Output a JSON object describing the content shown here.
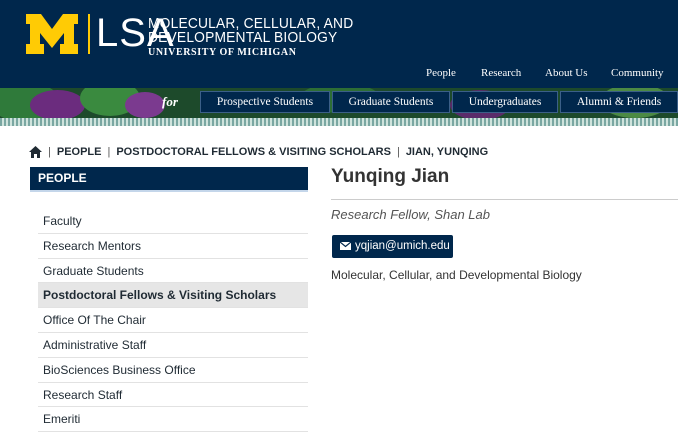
{
  "header": {
    "logo_text": "LSA",
    "department": {
      "line1": "MOLECULAR, CELLULAR, AND",
      "line2": "DEVELOPMENTAL BIOLOGY",
      "line3": "UNIVERSITY OF MICHIGAN"
    },
    "top_nav": [
      "People",
      "Research",
      "About Us",
      "Community"
    ],
    "for_label": "for",
    "audience_tabs": [
      "Prospective Students",
      "Graduate Students",
      "Undergraduates",
      "Alumni & Friends"
    ]
  },
  "breadcrumb": {
    "home_icon": "home-icon",
    "items": [
      "PEOPLE",
      "POSTDOCTORAL FELLOWS & VISITING SCHOLARS",
      "JIAN, YUNQING"
    ]
  },
  "sidebar": {
    "heading": "PEOPLE",
    "items": [
      {
        "label": "Faculty",
        "active": false
      },
      {
        "label": "Research Mentors",
        "active": false
      },
      {
        "label": "Graduate Students",
        "active": false
      },
      {
        "label": "Postdoctoral Fellows & Visiting Scholars",
        "active": true
      },
      {
        "label": "Office Of The Chair",
        "active": false
      },
      {
        "label": "Administrative Staff",
        "active": false
      },
      {
        "label": "BioSciences Business Office",
        "active": false
      },
      {
        "label": "Research Staff",
        "active": false
      },
      {
        "label": "Emeriti",
        "active": false
      }
    ]
  },
  "profile": {
    "name": "Yunqing Jian",
    "title": "Research Fellow, Shan Lab",
    "email": "yqjian@umich.edu",
    "email_icon": "envelope-icon",
    "department": "Molecular, Cellular, and Developmental Biology"
  },
  "colors": {
    "navy": "#00274c",
    "maize": "#ffcb05",
    "band_green": "#1d4a2b"
  }
}
